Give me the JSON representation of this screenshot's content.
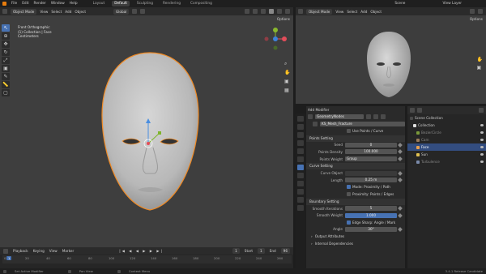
{
  "menu": {
    "items": [
      "File",
      "Edit",
      "Render",
      "Window",
      "Help"
    ]
  },
  "workspaces": [
    "Layout",
    "Default",
    "Sculpting",
    "Rendering",
    "Compositing"
  ],
  "active_workspace": "Default",
  "scene": "Scene",
  "view_layer": "View Layer",
  "viewport": {
    "mode": "Object Mode",
    "menus": [
      "View",
      "Select",
      "Add",
      "Object"
    ],
    "orientation": "Global",
    "options": "Options",
    "overlay_title": "Front Orthographic",
    "overlay_collection": "(1) Collection | Face",
    "overlay_units": "Centimeters"
  },
  "right_viewport": {
    "mode": "Object Mode",
    "menus": [
      "View",
      "Select",
      "Add",
      "Object"
    ],
    "options": "Options"
  },
  "props": {
    "add_modifier": "Add Modifier",
    "node_group": "GeometryNodes",
    "modifier_name": "KS_Mesh_Fracture",
    "use_points": "Use Points / Curve",
    "sec_points": "Points Setting",
    "seed_label": "Seed",
    "seed": "0",
    "density_label": "Points Density",
    "density": "100.000",
    "weight_label": "Points Weight",
    "weight": "Group",
    "sec_curve": "Curve Setting",
    "curve_obj_label": "Curve Object",
    "length_label": "Length",
    "length": "0.25 m",
    "mode_prox": "Mode: Proximity / Path",
    "prox_pts": "Proximity: Points / Edges",
    "sec_boundary": "Boundary Setting",
    "smooth_iter_label": "Smooth Iterations",
    "smooth_iter": "5",
    "smooth_weight_label": "Smooth Weight",
    "smooth_weight": "1.000",
    "edge_sharp": "Edge Sharp: Angle / Mark",
    "angle_label": "Angle",
    "angle": "30°",
    "output_attr": "Output Attributes",
    "internal_dep": "Internal Dependencies"
  },
  "outliner": {
    "root": "Scene Collection",
    "items": [
      {
        "label": "Collection",
        "selected": false,
        "dim": false
      },
      {
        "label": "BezierCircle",
        "selected": false,
        "dim": true
      },
      {
        "label": "Cam",
        "selected": false,
        "dim": true
      },
      {
        "label": "Face",
        "selected": true,
        "dim": false
      },
      {
        "label": "Sun",
        "selected": false,
        "dim": false
      },
      {
        "label": "Turbulence",
        "selected": false,
        "dim": true
      }
    ]
  },
  "timeline": {
    "menus": [
      "Playback",
      "Keying",
      "View",
      "Marker"
    ],
    "current_frame": "1",
    "start_label": "Start",
    "start": "1",
    "end_label": "End",
    "end": "96",
    "ticks": [
      "0",
      "20",
      "40",
      "60",
      "80",
      "100",
      "120",
      "140",
      "160",
      "180",
      "200",
      "220",
      "240",
      "260"
    ]
  },
  "status": {
    "left": "Set Active Modifier",
    "mid": "Pan View",
    "right": "Context Menu",
    "version": "3.4.1 Release Candidate"
  }
}
